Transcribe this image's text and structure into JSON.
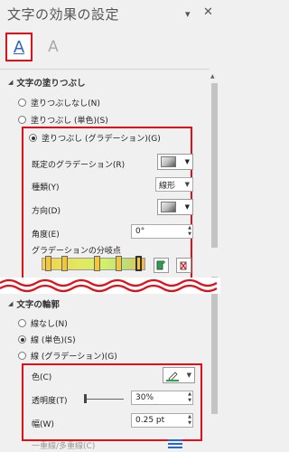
{
  "panel": {
    "title": "文字の効果の設定",
    "dropdown_glyph": "▾",
    "close_glyph": "✕"
  },
  "tabs": [
    {
      "id": "text-fill-outline",
      "label": "A",
      "selected": true
    },
    {
      "id": "text-effects",
      "label": "A",
      "selected": false
    }
  ],
  "fill_section": {
    "header": "文字の塗りつぶし",
    "options": [
      {
        "label": "塗りつぶしなし(N)",
        "selected": false
      },
      {
        "label": "塗りつぶし (単色)(S)",
        "selected": false
      },
      {
        "label": "塗りつぶし (グラデーション)(G)",
        "selected": true
      }
    ],
    "preset_label": "既定のグラデーション(R)",
    "type_label": "種類(Y)",
    "type_value": "線形",
    "direction_label": "方向(D)",
    "angle_label": "角度(E)",
    "angle_value": "0°",
    "stops_label": "グラデーションの分岐点"
  },
  "line_section": {
    "header": "文字の輪郭",
    "options": [
      {
        "label": "線なし(N)",
        "selected": false
      },
      {
        "label": "線 (単色)(S)",
        "selected": true
      },
      {
        "label": "線 (グラデーション)(G)",
        "selected": false
      }
    ],
    "color_label": "色(C)",
    "transparency_label": "透明度(T)",
    "transparency_value": "30%",
    "transparency_level": 0.3,
    "width_label": "幅(W)",
    "width_value": "0.25 pt",
    "compound_label": "一重線/多重線(C)"
  },
  "colors": {
    "accent_blue": "#2b67c7",
    "highlight_red": "#e0101a",
    "stop_yellow": "#f4c43c",
    "pen_green": "#2aa34a"
  },
  "icons": {
    "add_stop": "add-gradient-stop-icon",
    "remove_stop": "remove-gradient-stop-icon"
  }
}
